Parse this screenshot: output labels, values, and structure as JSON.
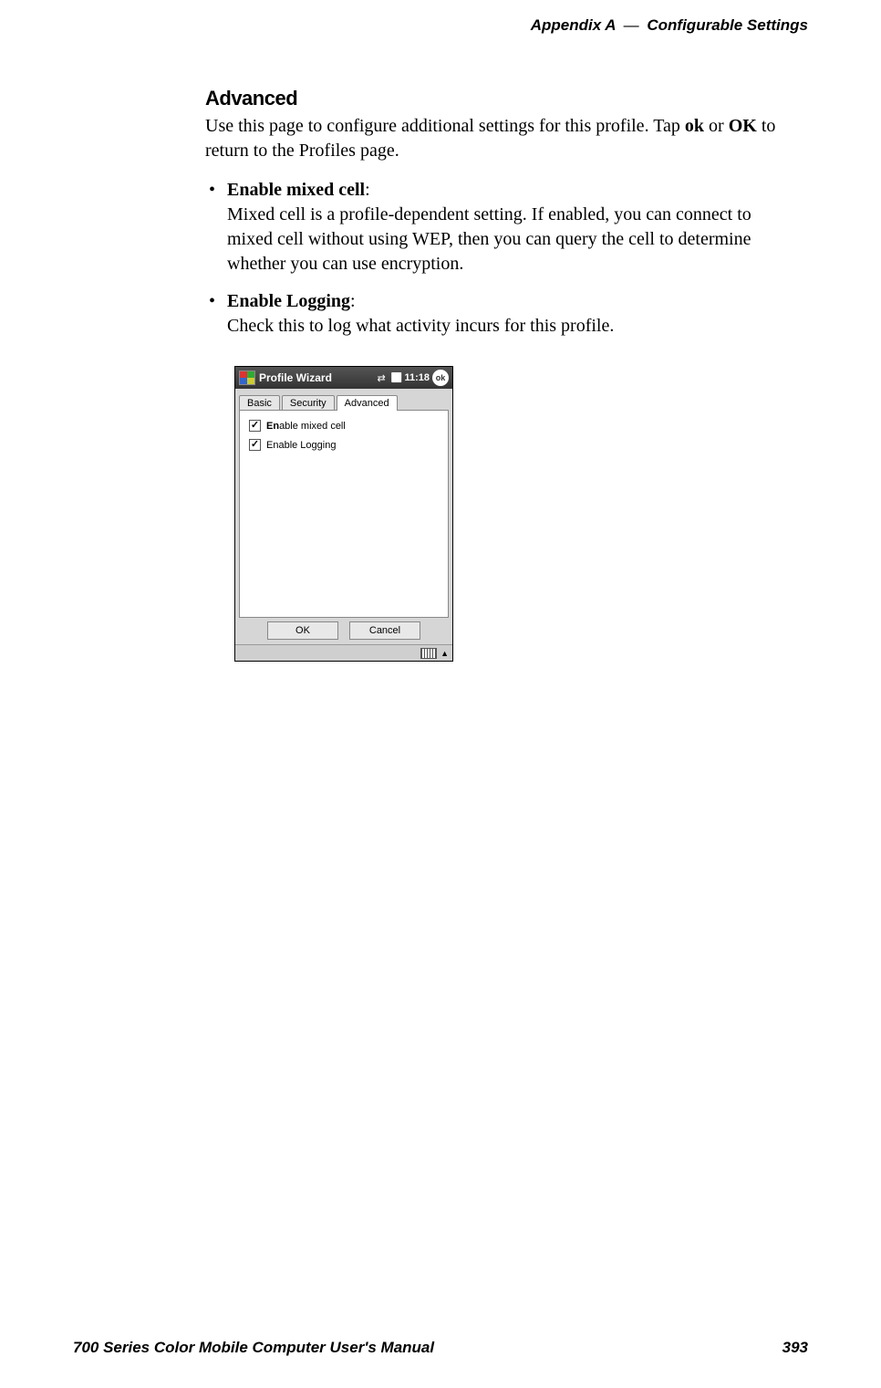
{
  "header": {
    "appendix": "Appendix A",
    "dash": "—",
    "title": "Configurable Settings"
  },
  "section": {
    "title": "Advanced",
    "intro_pre": "Use this page to configure additional settings for this profile. Tap ",
    "intro_ok1": "ok",
    "intro_mid": " or ",
    "intro_ok2": "OK",
    "intro_post": " to return to the Profiles page."
  },
  "bullets": [
    {
      "title": "Enable mixed cell",
      "colon": ":",
      "body": "Mixed cell is a profile-dependent setting. If enabled, you can connect to mixed cell without using WEP, then you can query the cell to determine whether you can use encryption."
    },
    {
      "title": "Enable Logging",
      "colon": ":",
      "body": "Check this to log what activity incurs for this profile."
    }
  ],
  "screenshot": {
    "titlebar": {
      "app_title": "Profile Wizard",
      "time": "11:18",
      "ok_label": "ok"
    },
    "tabs": {
      "basic": "Basic",
      "security": "Security",
      "advanced": "Advanced"
    },
    "checks": {
      "mixed_cell_label_bold": "En",
      "mixed_cell_label_rest": "able mixed cell",
      "logging_label": "Enable Logging"
    },
    "buttons": {
      "ok": "OK",
      "cancel": "Cancel"
    }
  },
  "footer": {
    "manual": "700 Series Color Mobile Computer User's Manual",
    "page": "393"
  }
}
